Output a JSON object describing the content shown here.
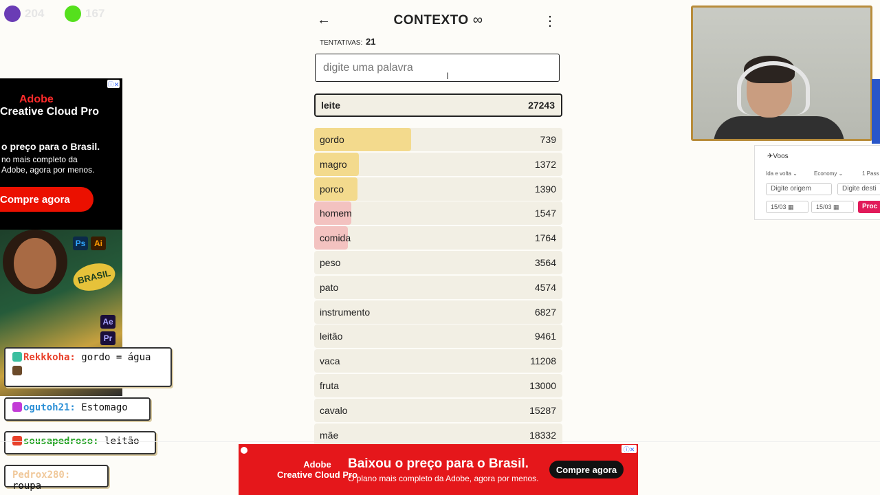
{
  "stream": {
    "counters": [
      {
        "value": "204",
        "color": "#6a3cb5"
      },
      {
        "value": "167",
        "color": "#55e01d"
      }
    ]
  },
  "game": {
    "title": "CONTEXTO",
    "title_icon": "infinity-icon",
    "tries_label": "TENTATIVAS:",
    "tries_value": "21",
    "input_placeholder": "digite uma palavra",
    "current": {
      "word": "leite",
      "rank": "27243"
    },
    "guesses": [
      {
        "word": "gordo",
        "rank": "739",
        "fill": 0.39,
        "color": "#f3da8d"
      },
      {
        "word": "magro",
        "rank": "1372",
        "fill": 0.18,
        "color": "#f3da8d"
      },
      {
        "word": "porco",
        "rank": "1390",
        "fill": 0.175,
        "color": "#f3da8d"
      },
      {
        "word": "homem",
        "rank": "1547",
        "fill": 0.15,
        "color": "#f3c2c0"
      },
      {
        "word": "comida",
        "rank": "1764",
        "fill": 0.135,
        "color": "#f3c2c0"
      },
      {
        "word": "peso",
        "rank": "3564",
        "fill": 0,
        "color": "#f3c2c0"
      },
      {
        "word": "pato",
        "rank": "4574",
        "fill": 0,
        "color": "#f3c2c0"
      },
      {
        "word": "instrumento",
        "rank": "6827",
        "fill": 0,
        "color": "#f3c2c0"
      },
      {
        "word": "leitão",
        "rank": "9461",
        "fill": 0,
        "color": "#f3c2c0"
      },
      {
        "word": "vaca",
        "rank": "11208",
        "fill": 0,
        "color": "#f3c2c0"
      },
      {
        "word": "fruta",
        "rank": "13000",
        "fill": 0,
        "color": "#f3c2c0"
      },
      {
        "word": "cavalo",
        "rank": "15287",
        "fill": 0,
        "color": "#f3c2c0"
      },
      {
        "word": "mãe",
        "rank": "18332",
        "fill": 0,
        "color": "#f3c2c0"
      }
    ]
  },
  "left_ad": {
    "logo": "Adobe",
    "product": "Creative Cloud Pro",
    "headline": "o preço para o Brasil.",
    "subtext": "no mais completo da Adobe, agora por menos.",
    "button": "Compre agora",
    "apps": [
      "Ps",
      "Ai",
      "Ae",
      "Pr"
    ],
    "badge": "BRASIL"
  },
  "flights": {
    "title": "Voos",
    "trip_type": "Ida e volta",
    "cabin": "Economy",
    "passengers": "1 Pass",
    "origin_placeholder": "Digite origem",
    "dest_placeholder": "Digite desti",
    "date1": "15/03",
    "date2": "15/03",
    "search_button": "Proc"
  },
  "chat": [
    {
      "user": "Rekkkoha:",
      "message": "gordo = água",
      "color": "#e8402a",
      "badge_color": "#3bbfa0"
    },
    {
      "user": "ogutoh21:",
      "message": "Estomago",
      "color": "#2b8fd6",
      "badge_color": "#c23bd6"
    },
    {
      "user": "sousapedroso:",
      "message": "leitão",
      "color": "#2aa52a",
      "badge_color": "#e8402a"
    },
    {
      "user": "Pedrox280:",
      "message": "roupa",
      "color": "#f0c89a",
      "badge_color": "#ffffff"
    }
  ],
  "bottom_ad": {
    "logo_line1": "Adobe",
    "logo_line2": "Creative Cloud Pro",
    "headline": "Baixou o preço para o Brasil.",
    "subtext": "O plano mais completo da Adobe, agora por menos.",
    "button": "Compre agora"
  }
}
